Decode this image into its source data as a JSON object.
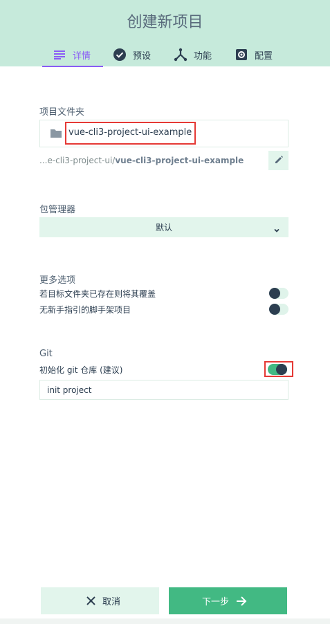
{
  "header": {
    "title": "创建新项目",
    "tabs": [
      {
        "label": "详情",
        "icon": "list-icon",
        "active": true
      },
      {
        "label": "预设",
        "icon": "check-circle-icon",
        "active": false
      },
      {
        "label": "功能",
        "icon": "branch-icon",
        "active": false
      },
      {
        "label": "配置",
        "icon": "settings-icon",
        "active": false
      }
    ]
  },
  "details": {
    "folder_label": "项目文件夹",
    "folder_value": "vue-cli3-project-ui-example",
    "path_prefix": "...e-cli3-project-ui/",
    "path_bold": "vue-cli3-project-ui-example",
    "package_manager_label": "包管理器",
    "package_manager_value": "默认",
    "more_options_label": "更多选项",
    "options": [
      {
        "label": "若目标文件夹已存在则将其覆盖",
        "enabled": false
      },
      {
        "label": "无新手指引的脚手架项目",
        "enabled": false
      }
    ],
    "git_label": "Git",
    "git_init_label": "初始化 git 仓库 (建议)",
    "git_init_enabled": true,
    "commit_message": "init project"
  },
  "footer": {
    "cancel_label": "取消",
    "next_label": "下一步"
  },
  "colors": {
    "header_bg": "#c6eadb",
    "accent": "#42b983",
    "tab_active": "#8a5cf5",
    "highlight": "#e53935"
  }
}
